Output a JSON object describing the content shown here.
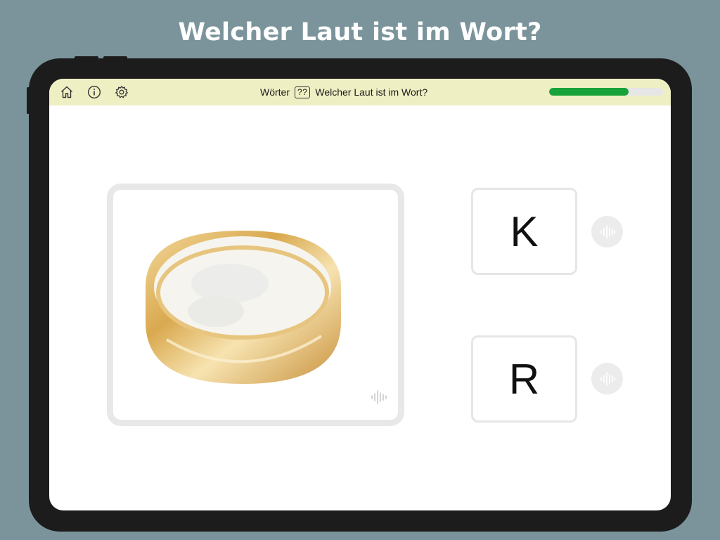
{
  "headline": "Welcher Laut ist im Wort?",
  "topbar": {
    "icons": [
      "home-icon",
      "info-icon",
      "gear-icon"
    ],
    "category": "Wörter",
    "badge": "??",
    "title": "Welcher Laut ist im Wort?",
    "progress": 0.7,
    "progress_color": "#17a33a",
    "bar_color": "#efefc4"
  },
  "picture": {
    "subject": "ring-image",
    "audio_icon": "sound-wave-icon"
  },
  "options": [
    {
      "letter": "K",
      "audio_icon": "sound-wave-icon"
    },
    {
      "letter": "R",
      "audio_icon": "sound-wave-icon"
    }
  ],
  "colors": {
    "background": "#7b949b",
    "device": "#1c1c1c",
    "ring_gold": "#e0b86a"
  }
}
